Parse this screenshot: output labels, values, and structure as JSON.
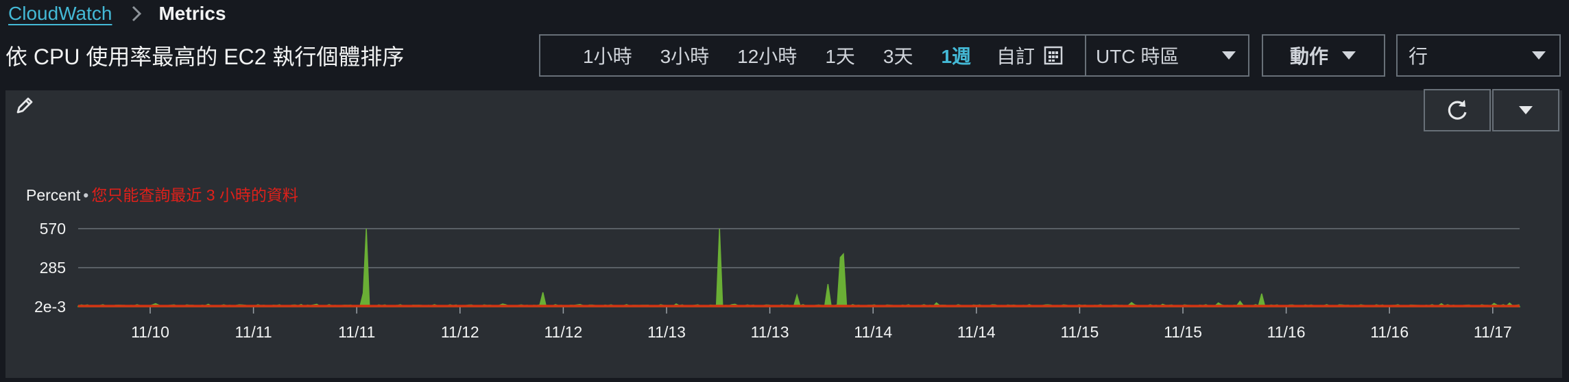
{
  "breadcrumb": {
    "root": "CloudWatch",
    "current": "Metrics"
  },
  "page_title": "依 CPU 使用率最高的 EC2 執行個體排序",
  "time_ranges": [
    {
      "label": "1小時",
      "active": false
    },
    {
      "label": "3小時",
      "active": false
    },
    {
      "label": "12小時",
      "active": false
    },
    {
      "label": "1天",
      "active": false
    },
    {
      "label": "3天",
      "active": false
    },
    {
      "label": "1週",
      "active": true
    }
  ],
  "custom_label": "自訂",
  "timezone": "UTC 時區",
  "actions_label": "動作",
  "layout_label": "行",
  "chart_note": {
    "unit": "Percent",
    "separator": "•",
    "warning": "您只能查詢最近 3 小時的資料"
  },
  "colors": {
    "accent": "#44b9d6",
    "series_green": "#6aaf35",
    "series_red": "#d13212",
    "warning": "#e0201a"
  },
  "icons": [
    "chevron-right-icon",
    "calendar-icon",
    "caret-down-icon",
    "pencil-icon",
    "refresh-icon"
  ],
  "chart_data": {
    "type": "area",
    "ylabel": "Percent",
    "yticks": [
      "570",
      "285",
      "2e-3"
    ],
    "ytick_values": [
      570,
      285,
      0.002
    ],
    "ylim": [
      0,
      570
    ],
    "xticks": [
      "11/10",
      "11/11",
      "11/11",
      "11/12",
      "11/12",
      "11/13",
      "11/13",
      "11/14",
      "11/14",
      "11/15",
      "11/15",
      "11/16",
      "11/16",
      "11/17"
    ],
    "x_range": [
      0,
      7
    ],
    "grid": true,
    "series": [
      {
        "color": "#6aaf35",
        "baseline": 6,
        "spikes": [
          [
            0.05,
            22
          ],
          [
            0.55,
            18
          ],
          [
            0.85,
            14
          ],
          [
            1.45,
            16
          ],
          [
            1.6,
            18
          ],
          [
            1.72,
            14
          ],
          [
            2.05,
            100
          ],
          [
            2.1,
            570
          ],
          [
            2.75,
            12
          ],
          [
            3.4,
            20
          ],
          [
            3.8,
            105
          ],
          [
            4.15,
            16
          ],
          [
            4.7,
            10
          ],
          [
            5.1,
            20
          ],
          [
            5.5,
            570
          ],
          [
            5.65,
            18
          ],
          [
            6.25,
            85
          ],
          [
            6.55,
            165
          ],
          [
            6.67,
            360
          ],
          [
            6.7,
            385
          ],
          [
            7.6,
            28
          ],
          [
            8.15,
            14
          ],
          [
            8.7,
            14
          ],
          [
            9.5,
            30
          ],
          [
            9.8,
            18
          ],
          [
            10.35,
            28
          ],
          [
            10.55,
            40
          ],
          [
            10.75,
            95
          ],
          [
            11.5,
            14
          ],
          [
            12.5,
            22
          ],
          [
            13.0,
            24
          ],
          [
            13.15,
            26
          ],
          [
            13.45,
            12
          ],
          [
            13.9,
            10
          ]
        ],
        "x_units": "days since first tick offset"
      },
      {
        "color": "#d13212",
        "constant": 0.002
      }
    ]
  }
}
